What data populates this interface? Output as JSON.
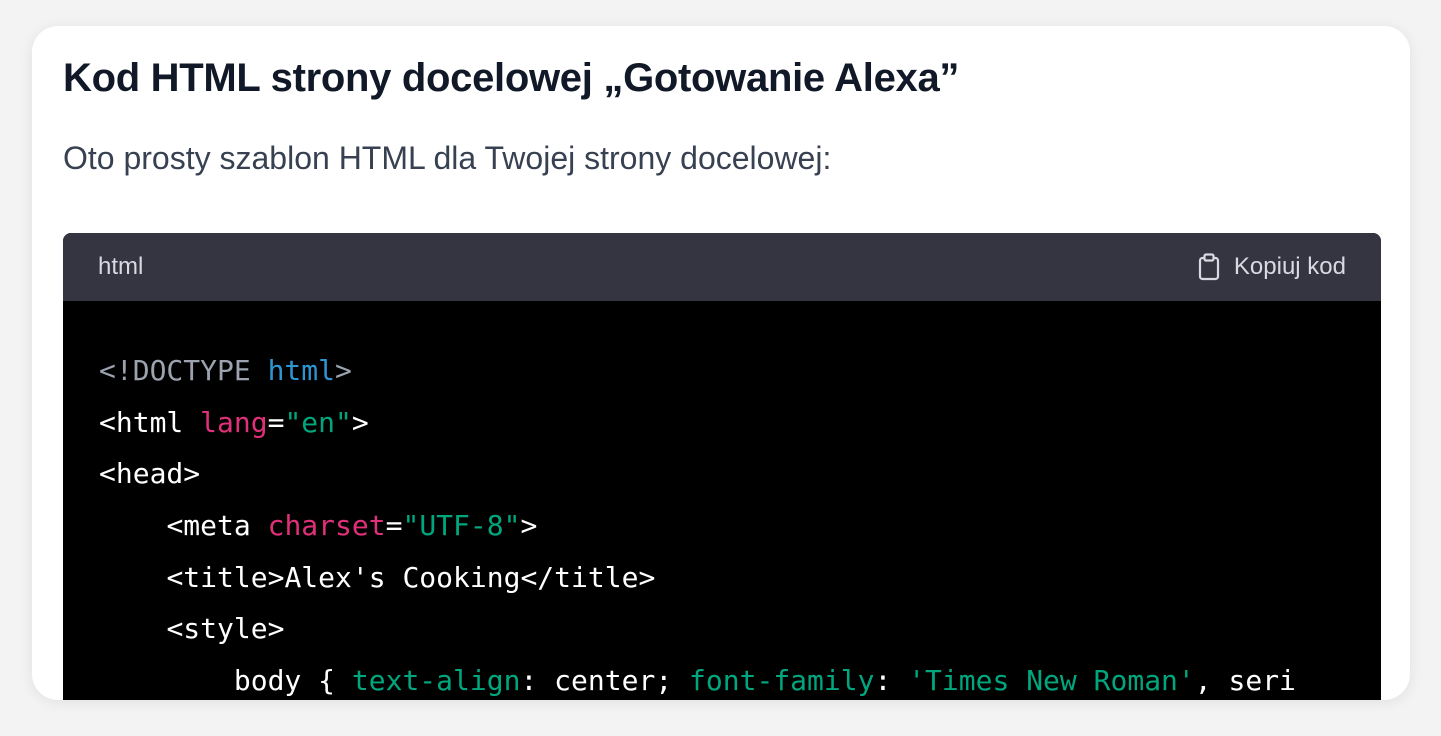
{
  "heading": "Kod HTML strony docelowej „Gotowanie Alexa”",
  "intro": "Oto prosty szablon HTML dla Twojej strony docelowej:",
  "code_block": {
    "language": "html",
    "copy_label": "Kopiuj kod",
    "copy_icon": "clipboard-icon",
    "colors": {
      "background": "#000000",
      "header": "#343541",
      "keyword": "#2e95d3",
      "attribute": "#df3079",
      "string": "#00a67d",
      "doctype": "#9ca3af"
    },
    "lines": [
      {
        "indent": 0,
        "tokens": [
          {
            "t": "<!DOCTYPE ",
            "c": "doctype"
          },
          {
            "t": "html",
            "c": "kw"
          },
          {
            "t": ">",
            "c": "doctype"
          }
        ]
      },
      {
        "indent": 0,
        "tokens": [
          {
            "t": "<html ",
            "c": "text"
          },
          {
            "t": "lang",
            "c": "attr"
          },
          {
            "t": "=",
            "c": "text"
          },
          {
            "t": "\"en\"",
            "c": "str"
          },
          {
            "t": ">",
            "c": "text"
          }
        ]
      },
      {
        "indent": 0,
        "tokens": [
          {
            "t": "<head>",
            "c": "text"
          }
        ]
      },
      {
        "indent": 1,
        "tokens": [
          {
            "t": "<meta ",
            "c": "text"
          },
          {
            "t": "charset",
            "c": "attr"
          },
          {
            "t": "=",
            "c": "text"
          },
          {
            "t": "\"UTF-8\"",
            "c": "str"
          },
          {
            "t": ">",
            "c": "text"
          }
        ]
      },
      {
        "indent": 1,
        "tokens": [
          {
            "t": "<title>Alex's Cooking</title>",
            "c": "text"
          }
        ]
      },
      {
        "indent": 1,
        "tokens": [
          {
            "t": "<style>",
            "c": "text"
          }
        ]
      },
      {
        "indent": 2,
        "tokens": [
          {
            "t": "body { ",
            "c": "text"
          },
          {
            "t": "text-align",
            "c": "prop"
          },
          {
            "t": ": center; ",
            "c": "text"
          },
          {
            "t": "font-family",
            "c": "prop"
          },
          {
            "t": ": ",
            "c": "text"
          },
          {
            "t": "'Times New Roman'",
            "c": "str"
          },
          {
            "t": ", seri",
            "c": "text"
          }
        ]
      }
    ]
  }
}
